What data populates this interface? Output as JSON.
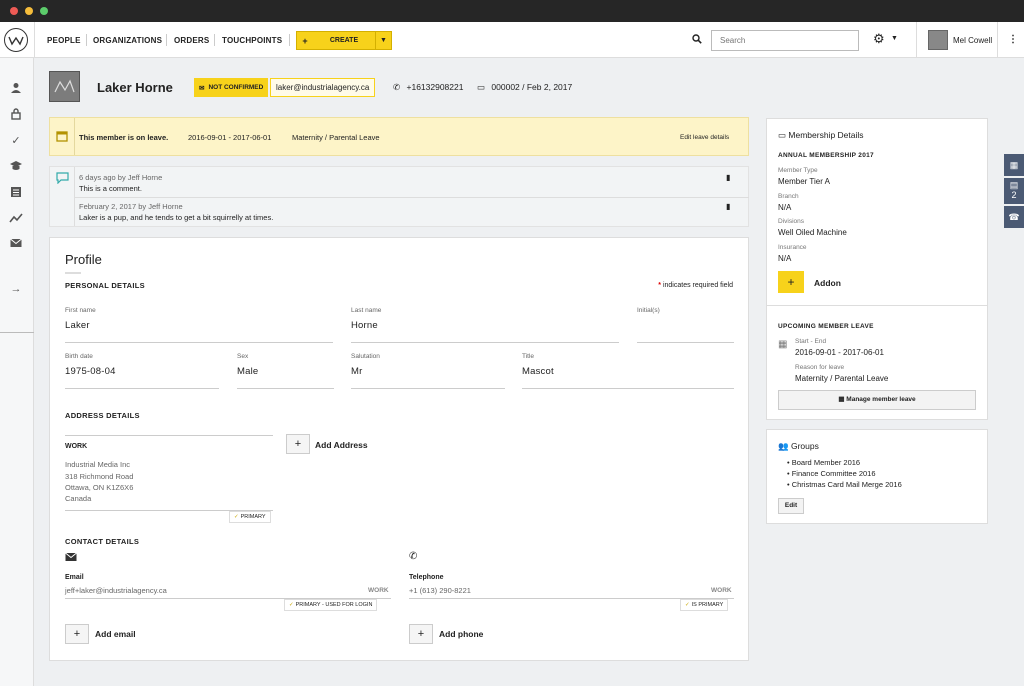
{
  "window": {
    "dot_colors": [
      "#ee5b55",
      "#f6bd3b",
      "#5ccc6b"
    ]
  },
  "nav": {
    "logo_icon": "crown-logo-icon",
    "links": [
      "PEOPLE",
      "ORGANIZATIONS",
      "ORDERS",
      "TOUCHPOINTS"
    ],
    "create_plus": "+",
    "create_label": "CREATE",
    "search_placeholder": "Search",
    "user_name": "Mel Cowell",
    "kebab": "⋮"
  },
  "member": {
    "name": "Laker Horne",
    "status": "NOT CONFIRMED",
    "email": "laker@industrialagency.ca",
    "phone": "+16132908221",
    "member_info": "000002 / Feb 2, 2017"
  },
  "leave_banner": {
    "message": "This member is on leave.",
    "dates": "2016-09-01 - 2017-06-01",
    "reason": "Maternity / Parental Leave",
    "edit_link": "Edit leave details"
  },
  "comments": [
    {
      "meta": "6 days ago by Jeff Horne",
      "text": "This is a comment."
    },
    {
      "meta": "February 2, 2017 by Jeff Horne",
      "text": "Laker is a pup, and he tends to get a bit squirrelly at times."
    }
  ],
  "profile": {
    "title": "Profile",
    "personal_heading": "PERSONAL DETAILS",
    "required_note": "indicates required field",
    "required_star": "*",
    "fields": {
      "first_name": {
        "label": "First name",
        "value": "Laker"
      },
      "last_name": {
        "label": "Last name",
        "value": "Horne"
      },
      "initials": {
        "label": "Initial(s)",
        "value": ""
      },
      "birth_date": {
        "label": "Birth date",
        "value": "1975-08-04"
      },
      "sex": {
        "label": "Sex",
        "value": "Male"
      },
      "salutation": {
        "label": "Salutation",
        "value": "Mr"
      },
      "title": {
        "label": "Title",
        "value": "Mascot"
      }
    },
    "address_heading": "ADDRESS DETAILS",
    "address": {
      "type": "WORK",
      "lines": [
        "Industrial Media Inc",
        "318 Richmond Road",
        "Ottawa, ON K1Z6X6",
        "Canada"
      ],
      "primary_tag": "PRIMARY"
    },
    "add_address": "Add Address",
    "contact_heading": "CONTACT DETAILS",
    "email": {
      "label": "Email",
      "value": "jeff+laker@industrialagency.ca",
      "type": "WORK",
      "tag": "PRIMARY - USED FOR LOGIN"
    },
    "telephone": {
      "label": "Telephone",
      "value": "+1 (613) 290-8221",
      "type": "WORK",
      "tag": "IS PRIMARY"
    },
    "add_email": "Add email",
    "add_phone": "Add phone"
  },
  "membership": {
    "heading": "Membership Details",
    "annual": "ANNUAL MEMBERSHIP 2017",
    "member_type_label": "Member Type",
    "member_type": "Member Tier A",
    "branch_label": "Branch",
    "branch": "N/A",
    "divisions_label": "Divisions",
    "divisions": "Well Oiled Machine",
    "insurance_label": "Insurance",
    "insurance": "N/A",
    "addon_label": "Addon",
    "upcoming_heading": "UPCOMING MEMBER LEAVE",
    "start_end_label": "Start - End",
    "start_end": "2016-09-01 - 2017-06-01",
    "reason_label": "Reason for leave",
    "reason": "Maternity / Parental Leave",
    "manage_button": "Manage member leave"
  },
  "groups": {
    "heading": "Groups",
    "items": [
      "Board Member 2016",
      "Finance Committee 2016",
      "Christmas Card Mail Merge 2016"
    ],
    "edit_button": "Edit"
  },
  "side_tabs": {
    "comments_count": "2"
  },
  "colors": {
    "accent": "#f7d21b",
    "leave_bg": "#fdf4c8",
    "side_tab": "#4b5a74"
  }
}
